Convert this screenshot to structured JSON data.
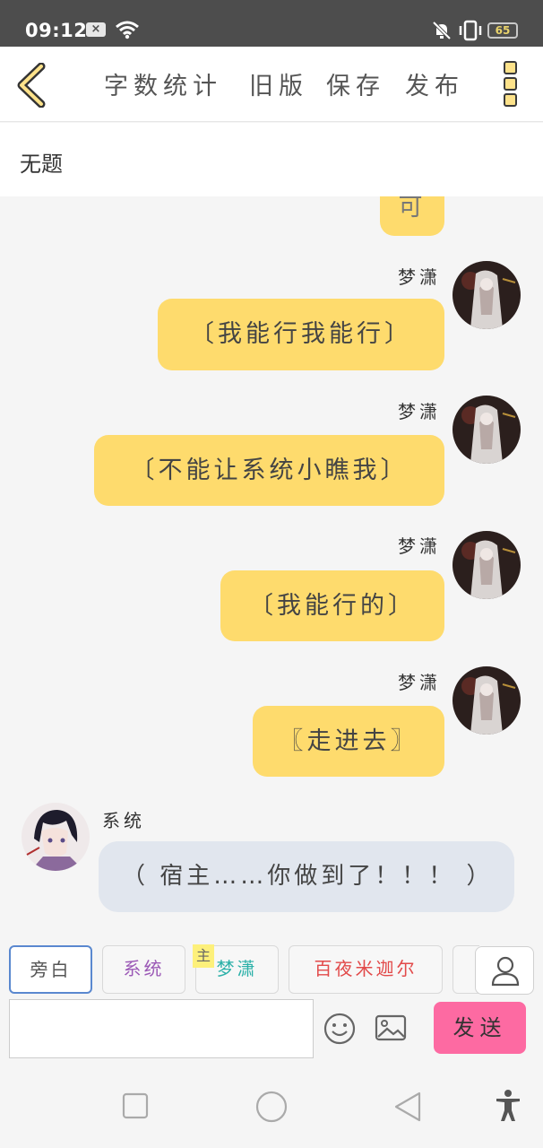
{
  "status_bar": {
    "time": "09:12",
    "battery": "65",
    "x_badge": "×"
  },
  "toolbar": {
    "word_count": "字数统计",
    "old_version": "旧版",
    "save": "保存",
    "publish": "发布"
  },
  "document": {
    "title": "无题"
  },
  "chat": {
    "partial_bubble_text": "可",
    "messages": [
      {
        "sender": "梦潇",
        "text": "〔我能行我能行〕",
        "side": "right"
      },
      {
        "sender": "梦潇",
        "text": "〔不能让系统小瞧我〕",
        "side": "right"
      },
      {
        "sender": "梦潇",
        "text": "〔我能行的〕",
        "side": "right"
      },
      {
        "sender": "梦潇",
        "text": "〖走进去〗",
        "side": "right"
      },
      {
        "sender": "系统",
        "text": "（ 宿主……你做到了！！！ ）",
        "side": "left"
      }
    ]
  },
  "roles": {
    "narration": "旁白",
    "system": "系统",
    "main_badge": "主",
    "main": "梦潇",
    "other": "百夜米迦尔"
  },
  "composer": {
    "input_value": "",
    "send": "发送"
  },
  "colors": {
    "bubble_right": "#fedb6d",
    "bubble_left": "#e1e6ee",
    "send_button": "#fd6aa2",
    "role_system": "#9b59b6",
    "role_main": "#2ab0a8",
    "role_other": "#e24a4a"
  }
}
